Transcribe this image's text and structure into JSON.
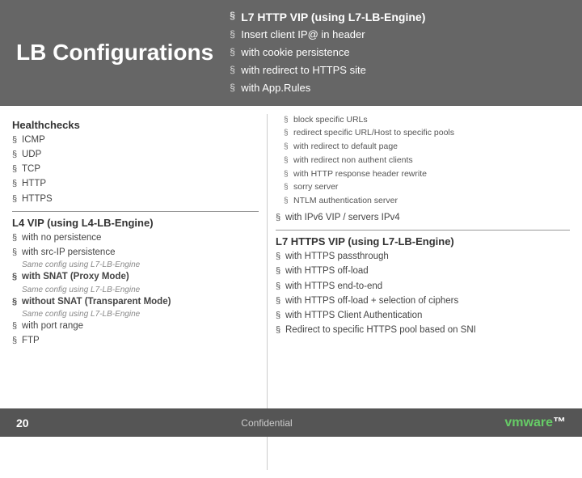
{
  "header": {
    "title": "LB Configurations",
    "right_title": "L7 HTTP VIP (using L7-LB-Engine)",
    "right_items": [
      "Insert client IP@ in header",
      "with cookie persistence",
      "with redirect to HTTPS site",
      "with App.Rules"
    ]
  },
  "left": {
    "section1_title": "Healthchecks",
    "section1_items": [
      "ICMP",
      "UDP",
      "TCP",
      "HTTP",
      "HTTPS"
    ],
    "section2_title": "L4 VIP (using L4-LB-Engine)",
    "section2_items": [
      "with no persistence",
      "with src-IP persistence"
    ],
    "note1": "Same config using L7-LB-Engine",
    "item3": "with SNAT (Proxy Mode)",
    "note2": "Same config using L7-LB-Engine",
    "item4": "without SNAT (Transparent Mode)",
    "note3": "Same config using L7-LB-Engine",
    "item5": "with port range",
    "item6": "FTP"
  },
  "right": {
    "sub_bullets": [
      "block specific URLs",
      "redirect specific URL/Host to specific pools",
      "with redirect to default page",
      "with redirect non authent clients",
      "with HTTP response header rewrite",
      "sorry server",
      "NTLM authentication server"
    ],
    "ipv6": "with IPv6 VIP / servers IPv4",
    "section2_title": "L7 HTTPS VIP (using L7-LB-Engine)",
    "section2_items": [
      "with HTTPS passthrough",
      "with HTTPS off-load",
      "with HTTPS end-to-end",
      "with HTTPS off-load + selection of ciphers",
      "with HTTPS Client Authentication",
      "Redirect to specific HTTPS pool based on SNI"
    ]
  },
  "footer": {
    "page_number": "20",
    "label": "Confidential",
    "logo": "vm",
    "logo2": "ware"
  }
}
